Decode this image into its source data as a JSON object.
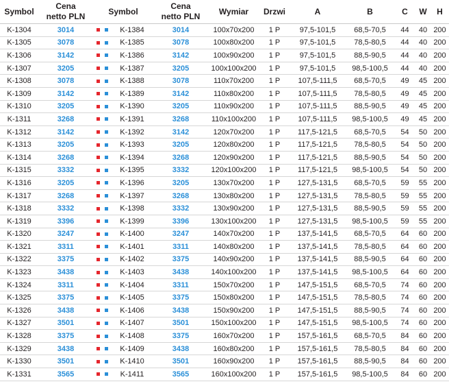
{
  "headers": {
    "symbol": "Symbol",
    "price_line1": "Cena",
    "price_line2": "netto PLN",
    "symbol2": "Symbol",
    "price2_line1": "Cena",
    "price2_line2": "netto PLN",
    "dim": "Wymiar",
    "doors": "Drzwi",
    "a": "A",
    "b": "B",
    "c": "C",
    "w": "W",
    "h": "H"
  },
  "colors": {
    "price": "#2a8fd8",
    "marker_red": "#e5262d",
    "marker_blue": "#2a8fd8"
  },
  "rows": [
    {
      "sym1": "K-1304",
      "price1": "3014",
      "sym2": "K-1384",
      "price2": "3014",
      "dim": "100x70x200",
      "doors": "1 P",
      "a": "97,5-101,5",
      "b": "68,5-70,5",
      "c": "44",
      "w": "40",
      "h": "200"
    },
    {
      "sym1": "K-1305",
      "price1": "3078",
      "sym2": "K-1385",
      "price2": "3078",
      "dim": "100x80x200",
      "doors": "1 P",
      "a": "97,5-101,5",
      "b": "78,5-80,5",
      "c": "44",
      "w": "40",
      "h": "200"
    },
    {
      "sym1": "K-1306",
      "price1": "3142",
      "sym2": "K-1386",
      "price2": "3142",
      "dim": "100x90x200",
      "doors": "1 P",
      "a": "97,5-101,5",
      "b": "88,5-90,5",
      "c": "44",
      "w": "40",
      "h": "200"
    },
    {
      "sym1": "K-1307",
      "price1": "3205",
      "sym2": "K-1387",
      "price2": "3205",
      "dim": "100x100x200",
      "doors": "1 P",
      "a": "97,5-101,5",
      "b": "98,5-100,5",
      "c": "44",
      "w": "40",
      "h": "200"
    },
    {
      "sym1": "K-1308",
      "price1": "3078",
      "sym2": "K-1388",
      "price2": "3078",
      "dim": "110x70x200",
      "doors": "1 P",
      "a": "107,5-111,5",
      "b": "68,5-70,5",
      "c": "49",
      "w": "45",
      "h": "200"
    },
    {
      "sym1": "K-1309",
      "price1": "3142",
      "sym2": "K-1389",
      "price2": "3142",
      "dim": "110x80x200",
      "doors": "1 P",
      "a": "107,5-111,5",
      "b": "78,5-80,5",
      "c": "49",
      "w": "45",
      "h": "200"
    },
    {
      "sym1": "K-1310",
      "price1": "3205",
      "sym2": "K-1390",
      "price2": "3205",
      "dim": "110x90x200",
      "doors": "1 P",
      "a": "107,5-111,5",
      "b": "88,5-90,5",
      "c": "49",
      "w": "45",
      "h": "200"
    },
    {
      "sym1": "K-1311",
      "price1": "3268",
      "sym2": "K-1391",
      "price2": "3268",
      "dim": "110x100x200",
      "doors": "1 P",
      "a": "107,5-111,5",
      "b": "98,5-100,5",
      "c": "49",
      "w": "45",
      "h": "200"
    },
    {
      "sym1": "K-1312",
      "price1": "3142",
      "sym2": "K-1392",
      "price2": "3142",
      "dim": "120x70x200",
      "doors": "1 P",
      "a": "117,5-121,5",
      "b": "68,5-70,5",
      "c": "54",
      "w": "50",
      "h": "200"
    },
    {
      "sym1": "K-1313",
      "price1": "3205",
      "sym2": "K-1393",
      "price2": "3205",
      "dim": "120x80x200",
      "doors": "1 P",
      "a": "117,5-121,5",
      "b": "78,5-80,5",
      "c": "54",
      "w": "50",
      "h": "200"
    },
    {
      "sym1": "K-1314",
      "price1": "3268",
      "sym2": "K-1394",
      "price2": "3268",
      "dim": "120x90x200",
      "doors": "1 P",
      "a": "117,5-121,5",
      "b": "88,5-90,5",
      "c": "54",
      "w": "50",
      "h": "200"
    },
    {
      "sym1": "K-1315",
      "price1": "3332",
      "sym2": "K-1395",
      "price2": "3332",
      "dim": "120x100x200",
      "doors": "1 P",
      "a": "117,5-121,5",
      "b": "98,5-100,5",
      "c": "54",
      "w": "50",
      "h": "200"
    },
    {
      "sym1": "K-1316",
      "price1": "3205",
      "sym2": "K-1396",
      "price2": "3205",
      "dim": "130x70x200",
      "doors": "1 P",
      "a": "127,5-131,5",
      "b": "68,5-70,5",
      "c": "59",
      "w": "55",
      "h": "200"
    },
    {
      "sym1": "K-1317",
      "price1": "3268",
      "sym2": "K-1397",
      "price2": "3268",
      "dim": "130x80x200",
      "doors": "1 P",
      "a": "127,5-131,5",
      "b": "78,5-80,5",
      "c": "59",
      "w": "55",
      "h": "200"
    },
    {
      "sym1": "K-1318",
      "price1": "3332",
      "sym2": "K-1398",
      "price2": "3332",
      "dim": "130x90x200",
      "doors": "1 P",
      "a": "127,5-131,5",
      "b": "88,5-90,5",
      "c": "59",
      "w": "55",
      "h": "200"
    },
    {
      "sym1": "K-1319",
      "price1": "3396",
      "sym2": "K-1399",
      "price2": "3396",
      "dim": "130x100x200",
      "doors": "1 P",
      "a": "127,5-131,5",
      "b": "98,5-100,5",
      "c": "59",
      "w": "55",
      "h": "200"
    },
    {
      "sym1": "K-1320",
      "price1": "3247",
      "sym2": "K-1400",
      "price2": "3247",
      "dim": "140x70x200",
      "doors": "1 P",
      "a": "137,5-141,5",
      "b": "68,5-70,5",
      "c": "64",
      "w": "60",
      "h": "200"
    },
    {
      "sym1": "K-1321",
      "price1": "3311",
      "sym2": "K-1401",
      "price2": "3311",
      "dim": "140x80x200",
      "doors": "1 P",
      "a": "137,5-141,5",
      "b": "78,5-80,5",
      "c": "64",
      "w": "60",
      "h": "200"
    },
    {
      "sym1": "K-1322",
      "price1": "3375",
      "sym2": "K-1402",
      "price2": "3375",
      "dim": "140x90x200",
      "doors": "1 P",
      "a": "137,5-141,5",
      "b": "88,5-90,5",
      "c": "64",
      "w": "60",
      "h": "200"
    },
    {
      "sym1": "K-1323",
      "price1": "3438",
      "sym2": "K-1403",
      "price2": "3438",
      "dim": "140x100x200",
      "doors": "1 P",
      "a": "137,5-141,5",
      "b": "98,5-100,5",
      "c": "64",
      "w": "60",
      "h": "200"
    },
    {
      "sym1": "K-1324",
      "price1": "3311",
      "sym2": "K-1404",
      "price2": "3311",
      "dim": "150x70x200",
      "doors": "1 P",
      "a": "147,5-151,5",
      "b": "68,5-70,5",
      "c": "74",
      "w": "60",
      "h": "200"
    },
    {
      "sym1": "K-1325",
      "price1": "3375",
      "sym2": "K-1405",
      "price2": "3375",
      "dim": "150x80x200",
      "doors": "1 P",
      "a": "147,5-151,5",
      "b": "78,5-80,5",
      "c": "74",
      "w": "60",
      "h": "200"
    },
    {
      "sym1": "K-1326",
      "price1": "3438",
      "sym2": "K-1406",
      "price2": "3438",
      "dim": "150x90x200",
      "doors": "1 P",
      "a": "147,5-151,5",
      "b": "88,5-90,5",
      "c": "74",
      "w": "60",
      "h": "200"
    },
    {
      "sym1": "K-1327",
      "price1": "3501",
      "sym2": "K-1407",
      "price2": "3501",
      "dim": "150x100x200",
      "doors": "1 P",
      "a": "147,5-151,5",
      "b": "98,5-100,5",
      "c": "74",
      "w": "60",
      "h": "200"
    },
    {
      "sym1": "K-1328",
      "price1": "3375",
      "sym2": "K-1408",
      "price2": "3375",
      "dim": "160x70x200",
      "doors": "1 P",
      "a": "157,5-161,5",
      "b": "68,5-70,5",
      "c": "84",
      "w": "60",
      "h": "200"
    },
    {
      "sym1": "K-1329",
      "price1": "3438",
      "sym2": "K-1409",
      "price2": "3438",
      "dim": "160x80x200",
      "doors": "1 P",
      "a": "157,5-161,5",
      "b": "78,5-80,5",
      "c": "84",
      "w": "60",
      "h": "200"
    },
    {
      "sym1": "K-1330",
      "price1": "3501",
      "sym2": "K-1410",
      "price2": "3501",
      "dim": "160x90x200",
      "doors": "1 P",
      "a": "157,5-161,5",
      "b": "88,5-90,5",
      "c": "84",
      "w": "60",
      "h": "200"
    },
    {
      "sym1": "K-1331",
      "price1": "3565",
      "sym2": "K-1411",
      "price2": "3565",
      "dim": "160x100x200",
      "doors": "1 P",
      "a": "157,5-161,5",
      "b": "98,5-100,5",
      "c": "84",
      "w": "60",
      "h": "200"
    }
  ]
}
